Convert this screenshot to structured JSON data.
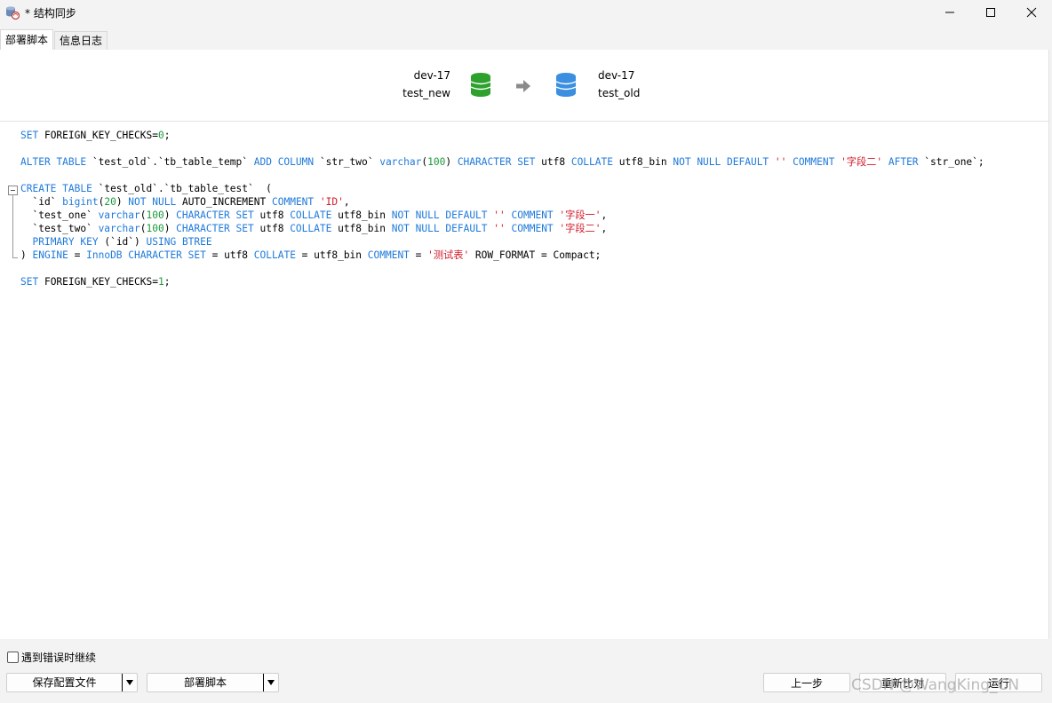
{
  "window": {
    "title": "* 结构同步",
    "icons": [
      "app-database-sync-icon",
      "minimize-icon",
      "maximize-icon",
      "close-icon"
    ]
  },
  "tabs": [
    {
      "label": "部署脚本",
      "active": true
    },
    {
      "label": "信息日志",
      "active": false
    }
  ],
  "source": {
    "connection": "dev-17",
    "database": "test_new",
    "color": "#2ea02e"
  },
  "target": {
    "connection": "dev-17",
    "database": "test_old",
    "color": "#3b8fe0"
  },
  "script_lines": [
    "SET FOREIGN_KEY_CHECKS=0;",
    "",
    "ALTER TABLE `test_old`.`tb_table_temp` ADD COLUMN `str_two` varchar(100) CHARACTER SET utf8 COLLATE utf8_bin NOT NULL DEFAULT '' COMMENT '字段二' AFTER `str_one`;",
    "",
    "CREATE TABLE `test_old`.`tb_table_test`  (",
    "  `id` bigint(20) NOT NULL AUTO_INCREMENT COMMENT 'ID',",
    "  `test_one` varchar(100) CHARACTER SET utf8 COLLATE utf8_bin NOT NULL DEFAULT '' COMMENT '字段一',",
    "  `test_two` varchar(100) CHARACTER SET utf8 COLLATE utf8_bin NOT NULL DEFAULT '' COMMENT '字段二',",
    "  PRIMARY KEY (`id`) USING BTREE",
    ") ENGINE = InnoDB CHARACTER SET = utf8 COLLATE = utf8_bin COMMENT = '测试表' ROW_FORMAT = Compact;",
    "",
    "SET FOREIGN_KEY_CHECKS=1;"
  ],
  "footer": {
    "continue_on_error_label": "遇到错误时继续",
    "continue_on_error_checked": false,
    "save_config_label": "保存配置文件",
    "deploy_script_label": "部署脚本",
    "prev_label": "上一步",
    "recompare_label": "重新比对",
    "run_label": "运行",
    "watermark": "CSDN @WangKing_CN"
  }
}
